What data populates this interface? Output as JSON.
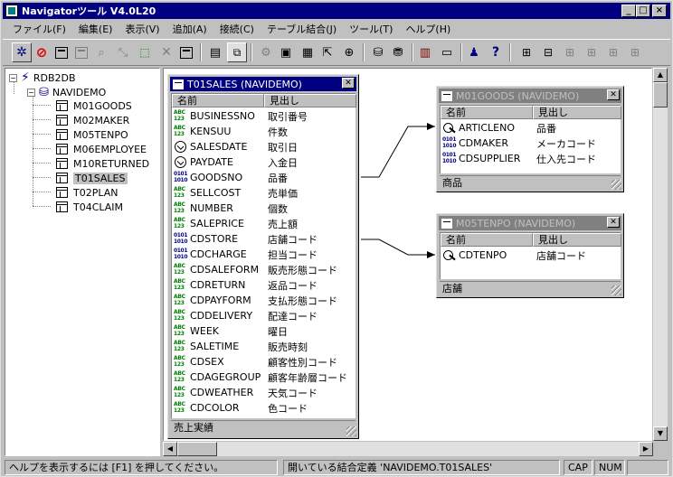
{
  "window": {
    "title": "Navigatorツール V4.0L20",
    "controls": {
      "minimize": "_",
      "maximize": "□",
      "close": "×"
    }
  },
  "menu": [
    "ファイル(F)",
    "編集(E)",
    "表示(V)",
    "追加(A)",
    "接続(C)",
    "テーブル結合(J)",
    "ツール(T)",
    "ヘルプ(H)"
  ],
  "toolbar": {
    "buttons": [
      "connect-icon",
      "stop-icon",
      "new-table-icon",
      "table-properties-icon",
      "query-icon",
      "join-icon",
      "relation-icon",
      "delete-icon",
      "print-icon",
      "grid-view-icon",
      "diagram-view-icon",
      "add-table-icon",
      "add-field-icon",
      "add-index-icon",
      "add-link-icon",
      "add-join-icon",
      "cylinder-icon",
      "cylinder-edit-icon",
      "clipboard-icon",
      "window-icon",
      "user-icon",
      "help-icon",
      "tree-icon-1",
      "tree-icon-2",
      "tree-icon-3",
      "tree-icon-4",
      "tree-icon-5",
      "tree-icon-6"
    ]
  },
  "tree": {
    "root": "RDB2DB",
    "schema": "NAVIDEMO",
    "tables": [
      "M01GOODS",
      "M02MAKER",
      "M05TENPO",
      "M06EMPLOYEE",
      "M10RETURNED",
      "T01SALES",
      "T02PLAN",
      "T04CLAIM"
    ],
    "selected": "T01SALES",
    "toggle_minus": "−"
  },
  "tables": {
    "t01sales": {
      "title": "T01SALES (NAVIDEMO)",
      "col_name": "名前",
      "col_caption": "見出し",
      "fields": [
        {
          "type": "abc",
          "name": "BUSINESSNO",
          "caption": "取引番号"
        },
        {
          "type": "abc",
          "name": "KENSUU",
          "caption": "件数"
        },
        {
          "type": "date",
          "name": "SALESDATE",
          "caption": "取引日"
        },
        {
          "type": "date",
          "name": "PAYDATE",
          "caption": "入金日"
        },
        {
          "type": "bin",
          "name": "GOODSNO",
          "caption": "品番"
        },
        {
          "type": "abc",
          "name": "SELLCOST",
          "caption": "売単価"
        },
        {
          "type": "abc",
          "name": "NUMBER",
          "caption": "個数"
        },
        {
          "type": "abc",
          "name": "SALEPRICE",
          "caption": "売上額"
        },
        {
          "type": "bin",
          "name": "CDSTORE",
          "caption": "店舗コード"
        },
        {
          "type": "bin",
          "name": "CDCHARGE",
          "caption": "担当コード"
        },
        {
          "type": "abc",
          "name": "CDSALEFORM",
          "caption": "販売形態コード"
        },
        {
          "type": "abc",
          "name": "CDRETURN",
          "caption": "返品コード"
        },
        {
          "type": "abc",
          "name": "CDPAYFORM",
          "caption": "支払形態コード"
        },
        {
          "type": "abc",
          "name": "CDDELIVERY",
          "caption": "配達コード"
        },
        {
          "type": "abc",
          "name": "WEEK",
          "caption": "曜日"
        },
        {
          "type": "abc",
          "name": "SALETIME",
          "caption": "販売時刻"
        },
        {
          "type": "abc",
          "name": "CDSEX",
          "caption": "顧客性別コード"
        },
        {
          "type": "abc",
          "name": "CDAGEGROUP",
          "caption": "顧客年齢層コード"
        },
        {
          "type": "abc",
          "name": "CDWEATHER",
          "caption": "天気コード"
        },
        {
          "type": "abc",
          "name": "CDCOLOR",
          "caption": "色コード"
        }
      ],
      "footer": "売上実績"
    },
    "m01goods": {
      "title": "M01GOODS (NAVIDEMO)",
      "col_name": "名前",
      "col_caption": "見出し",
      "fields": [
        {
          "type": "key",
          "name": "ARTICLENO",
          "caption": "品番"
        },
        {
          "type": "bin",
          "name": "CDMAKER",
          "caption": "メーカコード"
        },
        {
          "type": "bin",
          "name": "CDSUPPLIER",
          "caption": "仕入先コード"
        }
      ],
      "footer": "商品"
    },
    "m05tenpo": {
      "title": "M05TENPO (NAVIDEMO)",
      "col_name": "名前",
      "col_caption": "見出し",
      "fields": [
        {
          "type": "key",
          "name": "CDTENPO",
          "caption": "店舗コード"
        }
      ],
      "footer": "店舗"
    }
  },
  "statusbar": {
    "help": "ヘルプを表示するには [F1] を押してください。",
    "info": "開いている結合定義 'NAVIDEMO.T01SALES'",
    "cap": "CAP",
    "num": "NUM"
  }
}
